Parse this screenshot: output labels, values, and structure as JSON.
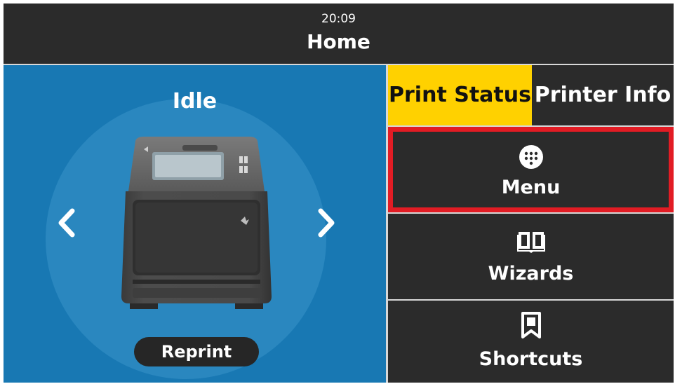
{
  "header": {
    "time": "20:09",
    "title": "Home"
  },
  "printer_panel": {
    "status": "Idle",
    "reprint_label": "Reprint",
    "prev_icon": "chevron-left-icon",
    "next_icon": "chevron-right-icon"
  },
  "tabs": [
    {
      "label": "Print Status",
      "selected": true
    },
    {
      "label": "Printer Info",
      "selected": false
    }
  ],
  "buttons": [
    {
      "label": "Menu",
      "icon": "grid-dots-icon",
      "highlighted": true
    },
    {
      "label": "Wizards",
      "icon": "book-icon",
      "highlighted": false
    },
    {
      "label": "Shortcuts",
      "icon": "bookmark-icon",
      "highlighted": false
    }
  ],
  "colors": {
    "accent_tab": "#ffd100",
    "left_panel": "#1878b3",
    "highlight_border": "#e21c24",
    "background": "#2b2b2b"
  }
}
